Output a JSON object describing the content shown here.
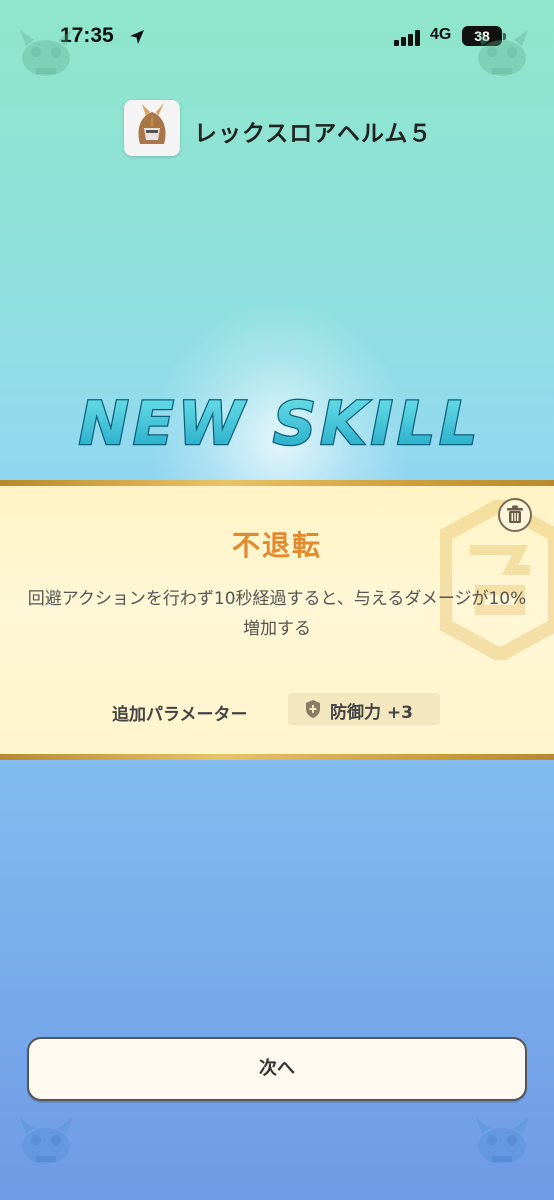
{
  "status_bar": {
    "time": "17:35",
    "network": "4G",
    "battery": "38"
  },
  "item": {
    "name": "レックスロアヘルム５"
  },
  "banner": {
    "title": "NEW SKILL"
  },
  "skill": {
    "name": "不退転",
    "description": "回避アクションを行わず10秒経過すると、与えるダメージが10%増加する",
    "param_label": "追加パラメーター",
    "param_value": "防御力 +3"
  },
  "actions": {
    "next_label": "次へ"
  },
  "colors": {
    "skill_name": "#e28a2f",
    "card_bg": "#fff7d6",
    "banner_fill": "#3bc6d8"
  }
}
